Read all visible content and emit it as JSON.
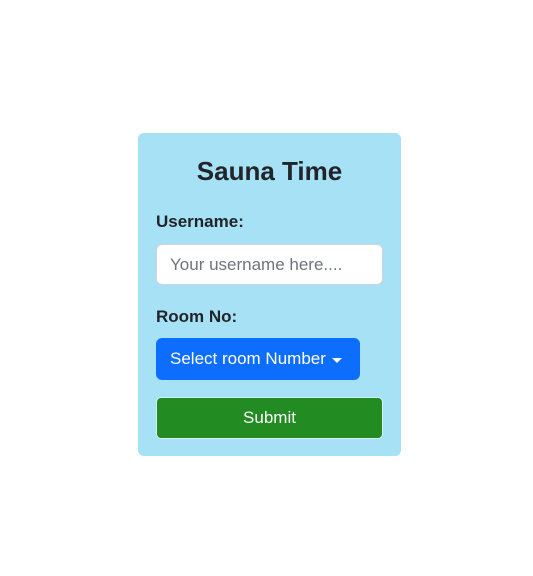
{
  "form": {
    "title": "Sauna Time",
    "username_label": "Username:",
    "username_placeholder": "Your username here....",
    "username_value": "",
    "room_label": "Room No:",
    "room_dropdown_label": "Select room Number",
    "submit_label": "Submit"
  },
  "colors": {
    "card_background": "#a6e1f5",
    "dropdown_button": "#0d6efd",
    "submit_button": "#228b22"
  },
  "icons": {
    "dropdown_caret": "caret-down-icon"
  }
}
